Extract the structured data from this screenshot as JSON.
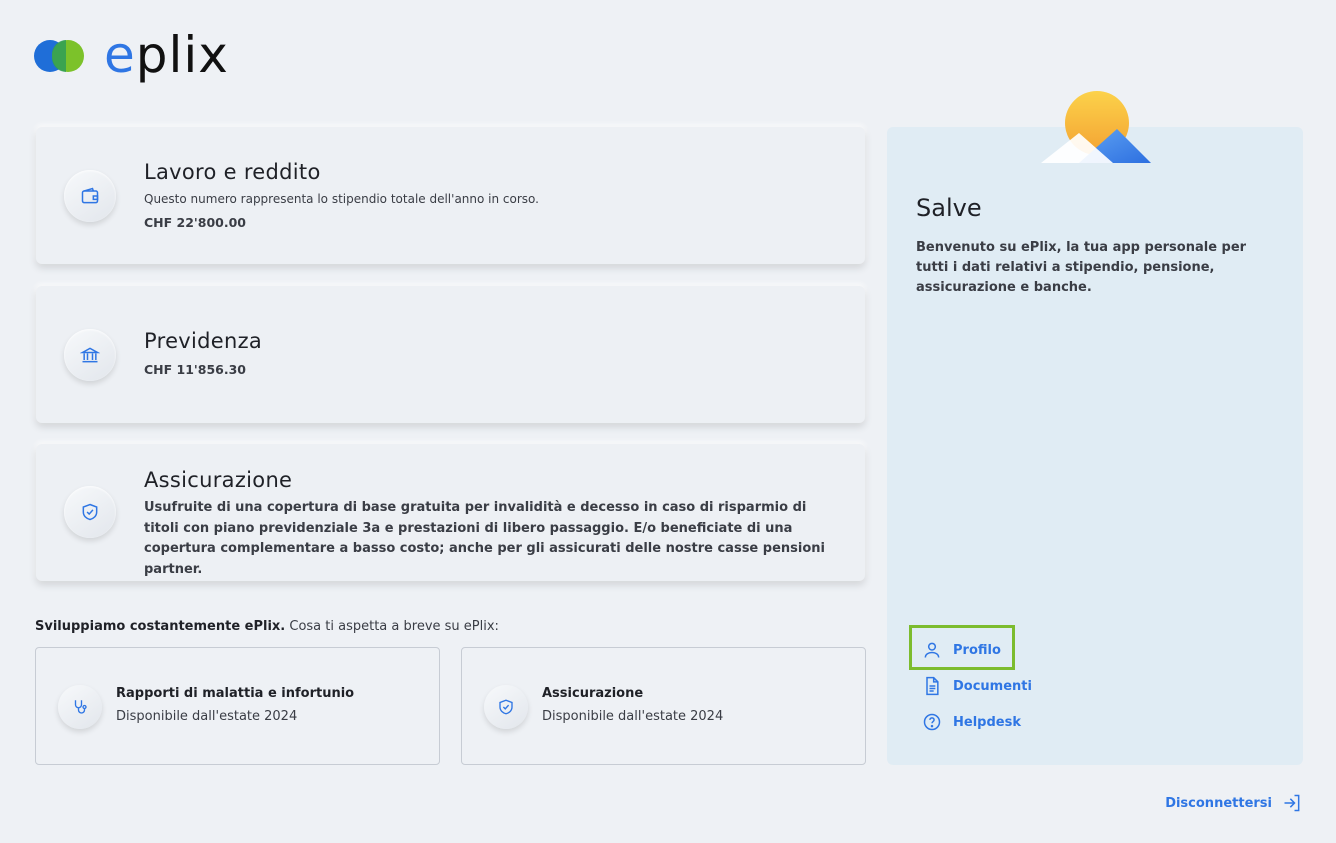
{
  "brand": {
    "name_e": "e",
    "name_rest": "plix"
  },
  "cards": [
    {
      "title": "Lavoro e reddito",
      "subtitle": "Questo numero rappresenta lo stipendio totale dell'anno in corso.",
      "amount": "CHF 22'800.00"
    },
    {
      "title": "Previdenza",
      "amount": "CHF 11'856.30"
    },
    {
      "title": "Assicurazione",
      "description": "Usufruite di una copertura di base gratuita per invalidità e decesso in caso di risparmio di titoli con piano previdenziale 3a e prestazioni di libero passaggio. E/o beneficiate di una copertura complementare a basso costo; anche per gli assicurati delle nostre casse pensioni partner."
    }
  ],
  "upcoming": {
    "heading_bold": "Sviluppiamo costantemente ePlix.",
    "heading_rest": " Cosa ti aspetta a breve su ePlix:",
    "items": [
      {
        "title": "Rapporti di malattia e infortunio",
        "subtitle": "Disponibile dall'estate 2024"
      },
      {
        "title": "Assicurazione",
        "subtitle": "Disponibile dall'estate 2024"
      }
    ]
  },
  "panel": {
    "title": "Salve",
    "text": "Benvenuto su ePlix, la tua app personale per tutti i dati relativi a stipendio, pensione, assicurazione e banche."
  },
  "menu": [
    {
      "label": "Profilo",
      "icon": "user-icon"
    },
    {
      "label": "Documenti",
      "icon": "document-icon"
    },
    {
      "label": "Helpdesk",
      "icon": "help-icon"
    }
  ],
  "logout": {
    "label": "Disconnettersi",
    "icon": "logout-icon"
  },
  "colors": {
    "accent": "#2f76e4",
    "highlight": "#7cbc2e",
    "background": "#eef1f5",
    "panel": "#e0ecf4"
  }
}
